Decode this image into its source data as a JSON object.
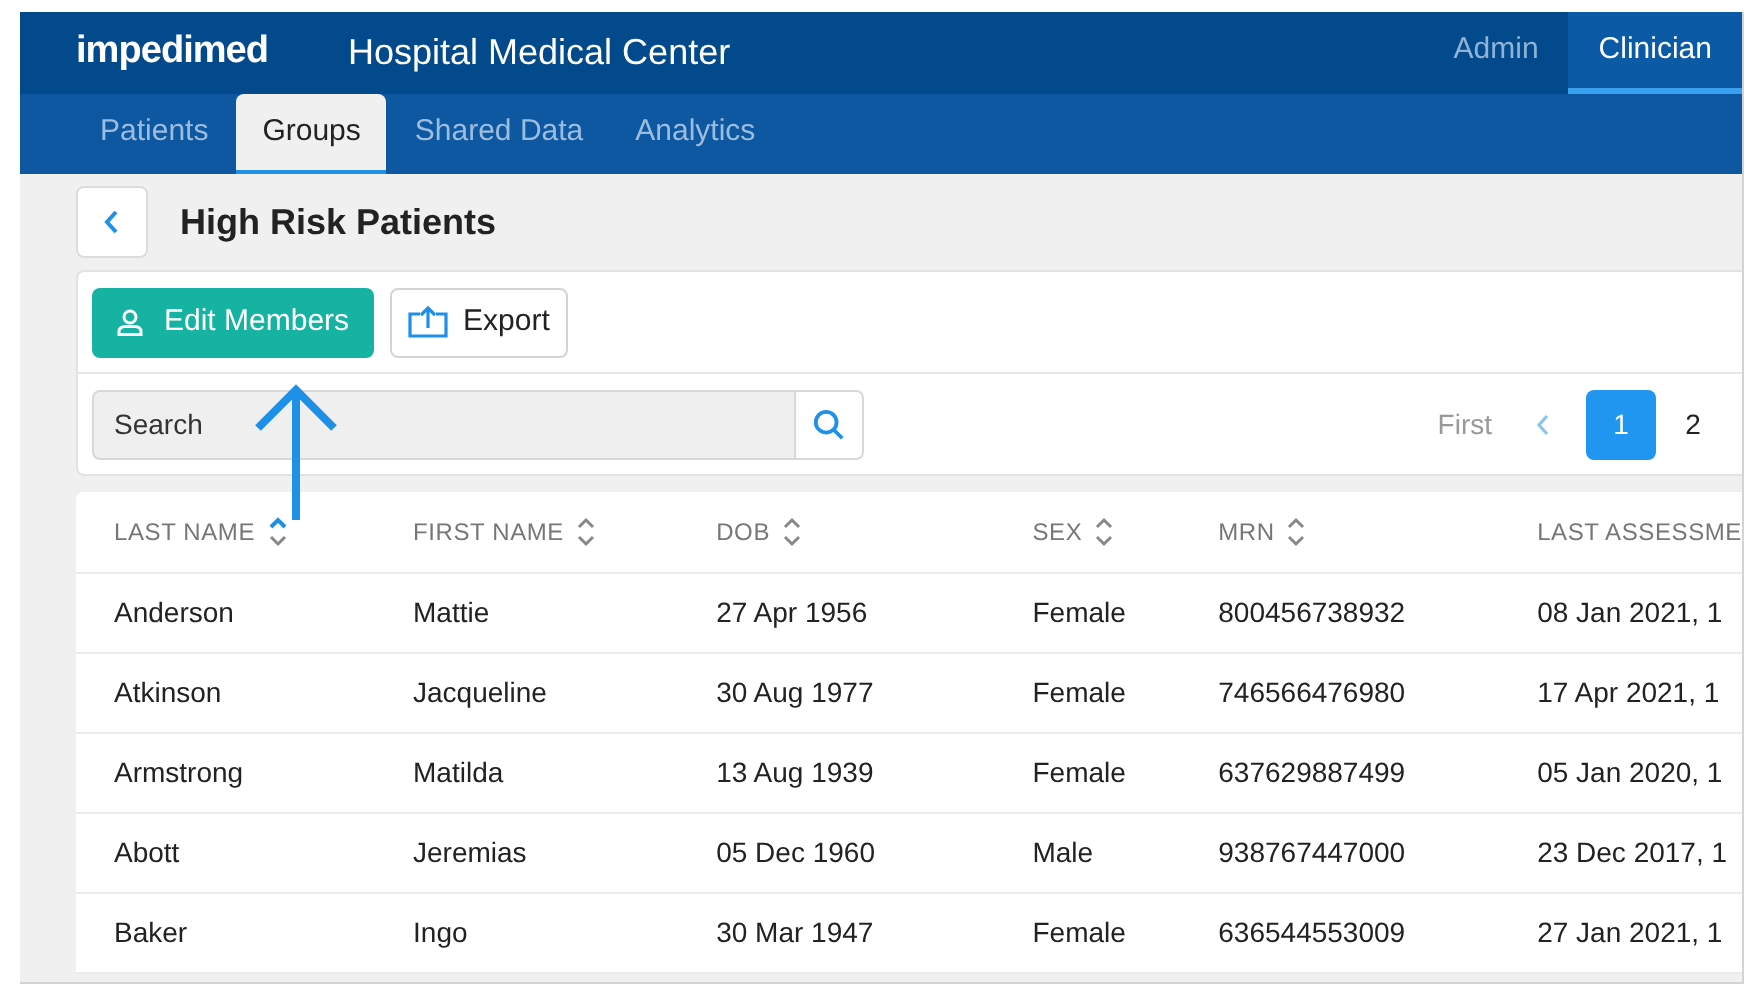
{
  "header": {
    "logo": "impedimed",
    "title": "Hospital Medical Center",
    "roles": [
      {
        "label": "Admin",
        "selected": false
      },
      {
        "label": "Clinician",
        "selected": true
      }
    ]
  },
  "tabs": [
    {
      "label": "Patients",
      "selected": false
    },
    {
      "label": "Groups",
      "selected": true
    },
    {
      "label": "Shared Data",
      "selected": false
    },
    {
      "label": "Analytics",
      "selected": false
    }
  ],
  "page_title": "High Risk Patients",
  "toolbar": {
    "buttons": [
      {
        "label": "Edit Members",
        "kind": "primary"
      },
      {
        "label": "Export",
        "kind": "secondary"
      }
    ]
  },
  "search": {
    "placeholder": "Search"
  },
  "pagination": {
    "first": "First",
    "pages": [
      {
        "label": "1",
        "selected": true
      },
      {
        "label": "2",
        "selected": false
      }
    ]
  },
  "table": {
    "columns": [
      {
        "label": "LAST NAME",
        "sort_active": true
      },
      {
        "label": "FIRST NAME",
        "sort_active": false
      },
      {
        "label": "DOB",
        "sort_active": false
      },
      {
        "label": "SEX",
        "sort_active": false
      },
      {
        "label": "MRN",
        "sort_active": false
      },
      {
        "label": "LAST ASSESSME"
      }
    ],
    "rows": [
      [
        "Anderson",
        "Mattie",
        "27 Apr 1956",
        "Female",
        "800456738932",
        "08 Jan 2021, 1"
      ],
      [
        "Atkinson",
        "Jacqueline",
        "30 Aug 1977",
        "Female",
        "746566476980",
        "17 Apr 2021, 1"
      ],
      [
        "Armstrong",
        "Matilda",
        "13 Aug 1939",
        "Female",
        "637629887499",
        "05 Jan 2020, 1"
      ],
      [
        "Abott",
        "Jeremias",
        "05 Dec 1960",
        "Male",
        "938767447000",
        "23 Dec 2017, 1"
      ],
      [
        "Baker",
        "Ingo",
        "30 Mar 1947",
        "Female",
        "636544553009",
        "27 Jan 2021, 1"
      ]
    ]
  }
}
